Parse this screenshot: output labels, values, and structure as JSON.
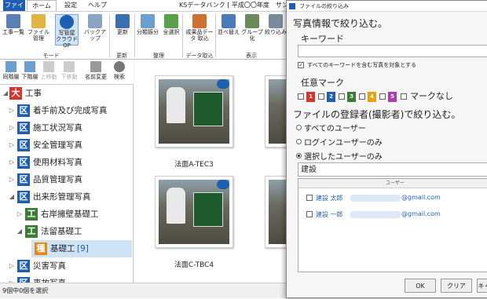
{
  "ribbon": {
    "tabs": {
      "file": "ファイル",
      "home": "ホーム",
      "settings": "設定",
      "help": "ヘルプ"
    },
    "title": "KSデータバンク [ 平成〇〇年度　サンプル工事",
    "buttons": [
      {
        "label": "工事一覧"
      },
      {
        "label": "ファイル管理"
      },
      {
        "label": "写管屋 クラウドOP"
      },
      {
        "label": "バックアップ"
      },
      {
        "label": "更新"
      },
      {
        "label": "分類振分"
      },
      {
        "label": "全選択"
      },
      {
        "label": "成果品データ 取込"
      },
      {
        "label": "並べ替え"
      },
      {
        "label": "グループ化"
      },
      {
        "label": "絞り込み"
      }
    ],
    "groups": {
      "mode": "モード",
      "update": "更新",
      "arrange": "整理",
      "data_import": "データ取込",
      "display": "表示"
    }
  },
  "left_toolbar": {
    "prev_level": "同階層",
    "next_level": "下階層",
    "move_up": "上移動",
    "move_down": "下移動",
    "rename": "名前変更",
    "search": "検索"
  },
  "tree": [
    {
      "badge": "大",
      "label": "工事"
    },
    {
      "badge": "区",
      "label": "着手前及び完成写真"
    },
    {
      "badge": "区",
      "label": "施工状況写真"
    },
    {
      "badge": "区",
      "label": "安全管理写真"
    },
    {
      "badge": "区",
      "label": "使用材料写真"
    },
    {
      "badge": "区",
      "label": "品質管理写真"
    },
    {
      "badge": "区",
      "label": "出来形管理写真"
    },
    {
      "badge": "工",
      "label": "右岸擁壁基礎工"
    },
    {
      "badge": "工",
      "label": "法留基礎工"
    },
    {
      "badge": "種",
      "label": "基礎工",
      "count": "[9]"
    },
    {
      "badge": "区",
      "label": "災害写真"
    },
    {
      "badge": "区",
      "label": "事故写真"
    }
  ],
  "photos": [
    {
      "caption": "法面A-TEC3"
    },
    {
      "caption": "法面C-TBC4"
    }
  ],
  "status": {
    "text": "9個中0個を選択"
  },
  "dialog": {
    "title": "ファイルの絞り込み",
    "section_photo": "写真情報で絞り込む。",
    "keyword_label": "キーワード",
    "keyword_value": "",
    "all_keywords_label": "すべてのキーワードを含む写真を対象とする",
    "marks_label": "任意マーク",
    "marks": [
      {
        "num": "1",
        "color": "#d9342b"
      },
      {
        "num": "2",
        "color": "#1e5fb4"
      },
      {
        "num": "3",
        "color": "#3b7d35"
      },
      {
        "num": "4",
        "color": "#e8a20f"
      },
      {
        "num": "5",
        "color": "#b03bb0"
      }
    ],
    "no_mark": "マークなし",
    "section_user": "ファイルの登録者(撮影者)で絞り込む。",
    "opt_all_users": "すべてのユーザー",
    "opt_login_user": "ログインユーザーのみ",
    "opt_selected_users": "選択したユーザーのみ",
    "user_search_value": "建設",
    "user_column": "ユーザー",
    "users": [
      {
        "name": "建設 太郎",
        "email_suffix": "@gmail.com"
      },
      {
        "name": "建設 一郎",
        "email_suffix": "@gmail.com"
      }
    ],
    "ok": "OK",
    "clear": "クリア",
    "cancel": "キャ"
  }
}
